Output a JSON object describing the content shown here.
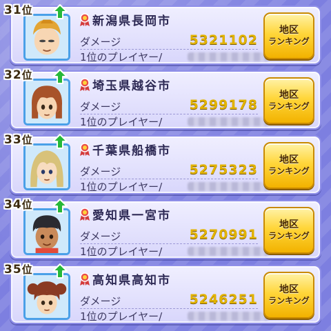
{
  "rankings": [
    {
      "rank_num": "31",
      "rank_suffix": "位",
      "city": "新潟県長岡市",
      "damage_label": "ダメージ",
      "damage": "5321102",
      "player_label": "1位のプレイヤー/",
      "button_line1": "地区",
      "button_line2": "ランキング"
    },
    {
      "rank_num": "32",
      "rank_suffix": "位",
      "city": "埼玉県越谷市",
      "damage_label": "ダメージ",
      "damage": "5299178",
      "player_label": "1位のプレイヤー/",
      "button_line1": "地区",
      "button_line2": "ランキング"
    },
    {
      "rank_num": "33",
      "rank_suffix": "位",
      "city": "千葉県船橋市",
      "damage_label": "ダメージ",
      "damage": "5275323",
      "player_label": "1位のプレイヤー/",
      "button_line1": "地区",
      "button_line2": "ランキング"
    },
    {
      "rank_num": "34",
      "rank_suffix": "位",
      "city": "愛知県一宮市",
      "damage_label": "ダメージ",
      "damage": "5270991",
      "player_label": "1位のプレイヤー/",
      "button_line1": "地区",
      "button_line2": "ランキング"
    },
    {
      "rank_num": "35",
      "rank_suffix": "位",
      "city": "高知県高知市",
      "damage_label": "ダメージ",
      "damage": "5246251",
      "player_label": "1位のプレイヤー/",
      "button_line1": "地区",
      "button_line2": "ランキング"
    }
  ],
  "icons": {
    "trend": "up-arrow-icon",
    "medal": "medal-icon"
  },
  "colors": {
    "background": "#7d7fe0",
    "damage_value": "#e2b300",
    "button_gold": "#ffd63a",
    "trend_green": "#27b83a"
  }
}
